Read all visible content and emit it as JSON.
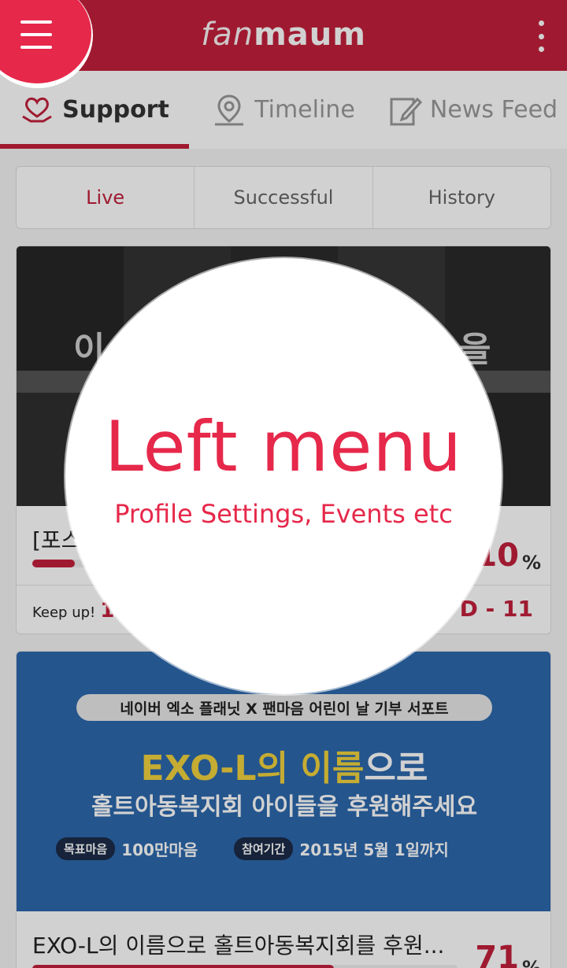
{
  "app": {
    "logo_thin": "fan",
    "logo_bold": "maum"
  },
  "colors": {
    "brand": "#c2203b",
    "accent": "#e6284a",
    "headline_yellow": "#f1d23d",
    "banner_blue": "#2d68ad"
  },
  "tabs": [
    {
      "label": "Support",
      "icon": "heart-hands-icon",
      "active": true
    },
    {
      "label": "Timeline",
      "icon": "map-pin-icon",
      "active": false
    },
    {
      "label": "News Feed",
      "icon": "edit-note-icon",
      "active": false
    }
  ],
  "segments": [
    {
      "label": "Live",
      "active": true
    },
    {
      "label": "Successful",
      "active": false
    },
    {
      "label": "History",
      "active": false
    }
  ],
  "cards": [
    {
      "banner_text_left": "이",
      "banner_text_right": "을",
      "title": "[포스",
      "percent": "10",
      "percent_sign": "%",
      "progress": 0.1,
      "footer_label": "Keep up!",
      "footer_count": "1",
      "dday": "D - 11"
    },
    {
      "banner_pill": "네이버 엑소 플래닛 X 팬마음 어린이 날 기부 서포트",
      "banner_headline_yellow": "EXO-L의 이름",
      "banner_headline_white": "으로",
      "banner_sub": "홀트아동복지회 아이들을 후원해주세요",
      "tag_goal": "목표마음",
      "goal_value": "100만마음",
      "tag_period": "참여기간",
      "period_value": "2015년 5월 1일까지",
      "title": "EXO-L의 이름으로 홀트아동복지회를 후원...",
      "percent": "71",
      "percent_sign": "%",
      "progress": 0.71
    }
  ],
  "coach": {
    "title": "Left menu",
    "subtitle": "Profile Settings, Events etc"
  }
}
